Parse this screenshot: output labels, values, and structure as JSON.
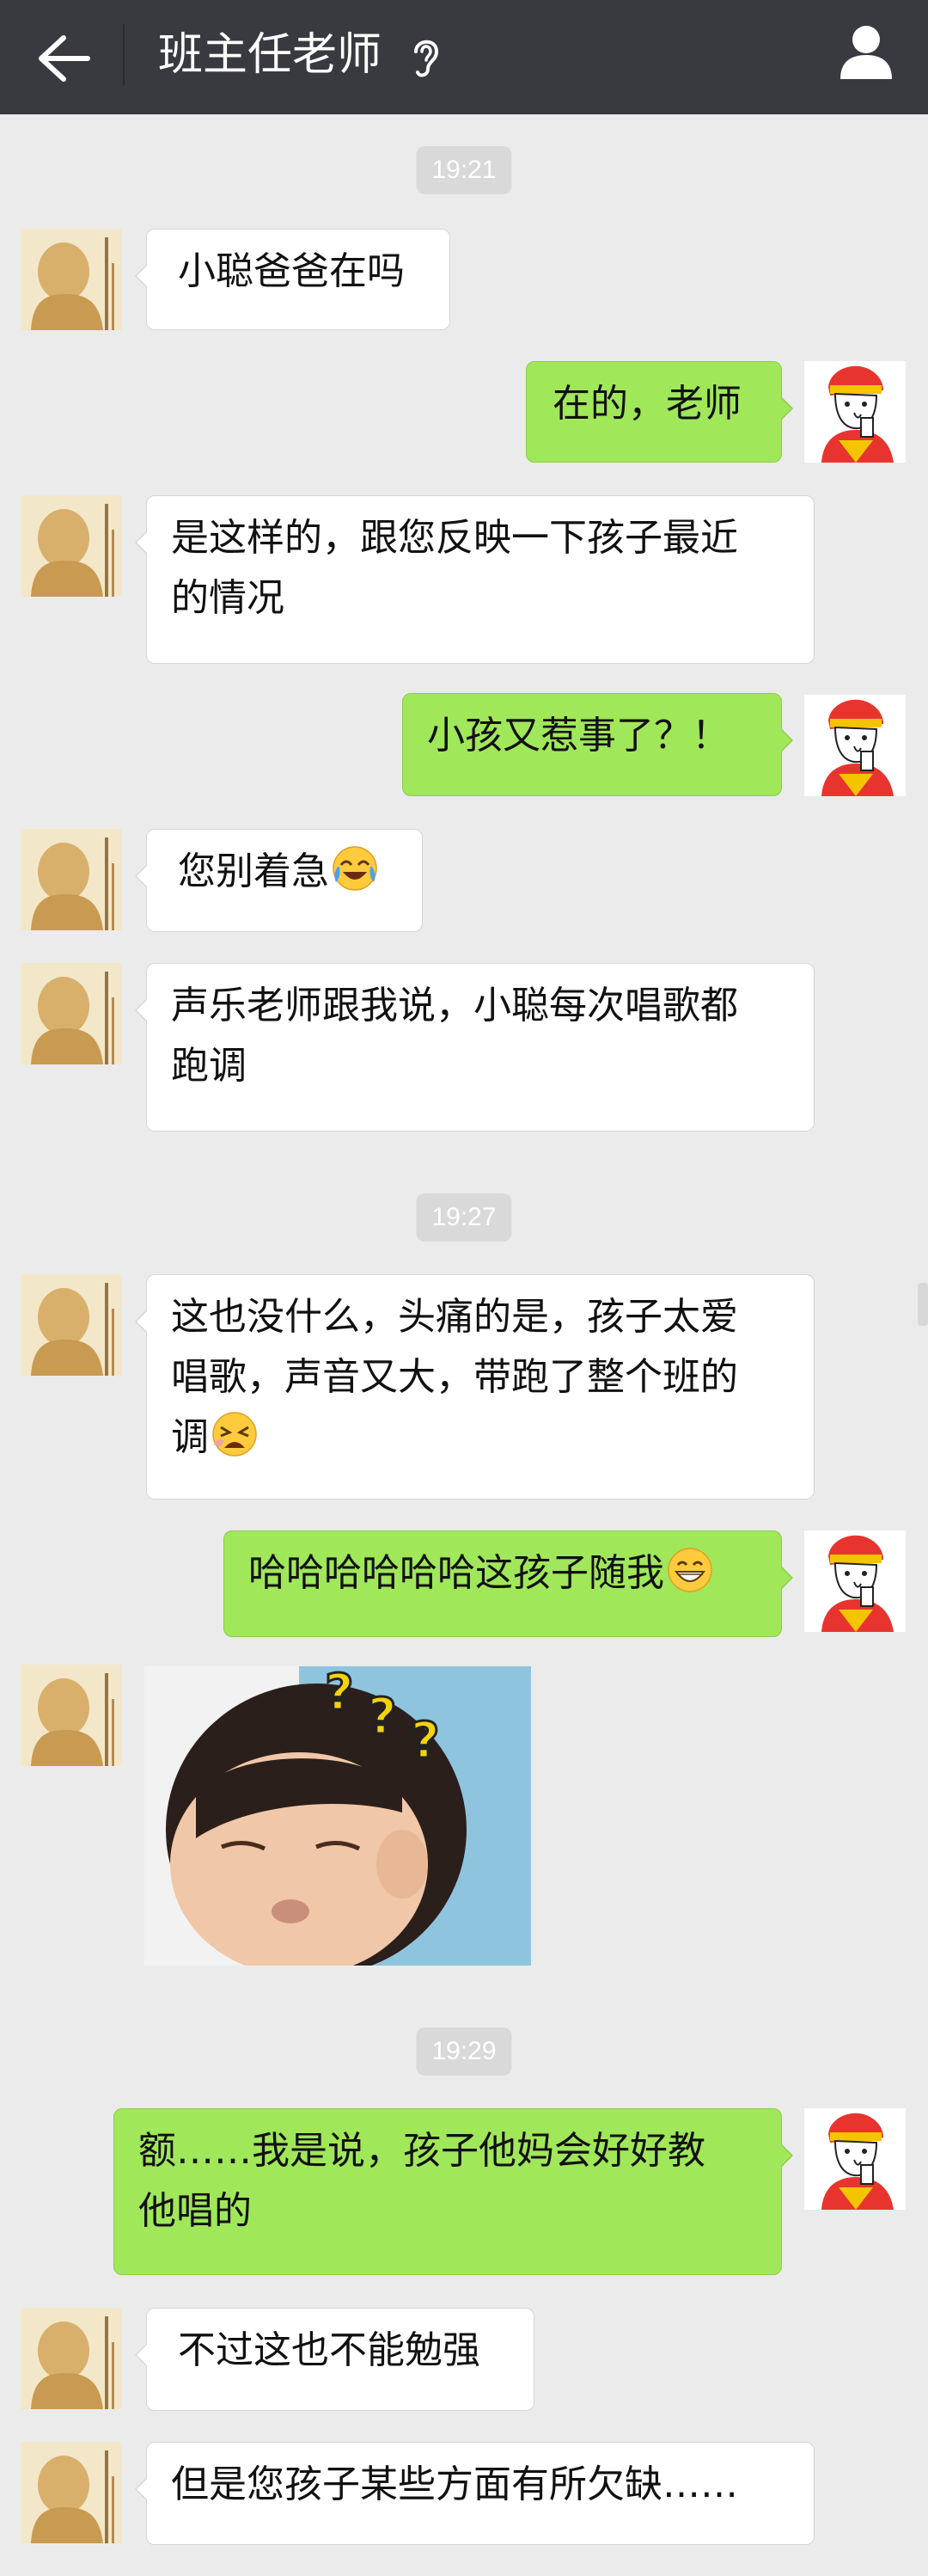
{
  "header": {
    "title": "班主任老师",
    "back_icon": "arrow-left-icon",
    "ear_icon": "ear-icon",
    "profile_icon": "user-icon"
  },
  "colors": {
    "topbar": "#393a3f",
    "background": "#ebebeb",
    "sent_bubble": "#a0e75a",
    "received_bubble": "#ffffff",
    "timestamp_bg": "#d9d9d9"
  },
  "timestamps": [
    "19:21",
    "19:27",
    "19:29"
  ],
  "messages": [
    {
      "side": "left",
      "text": "小聪爸爸在吗"
    },
    {
      "side": "right",
      "text": "在的，老师"
    },
    {
      "side": "left",
      "lines": [
        "是这样的，跟您反映一下孩子最近",
        "的情况"
      ]
    },
    {
      "side": "right",
      "text": "小孩又惹事了？！"
    },
    {
      "side": "left",
      "text": "您别着急",
      "emoji": "tears-of-joy-emoji"
    },
    {
      "side": "left",
      "lines": [
        "声乐老师跟我说，小聪每次唱歌都",
        "跑调"
      ]
    },
    {
      "side": "left",
      "lines": [
        "这也没什么，头痛的是，孩子太爱",
        "唱歌，声音又大，带跑了整个班的",
        "调"
      ],
      "emoji": "tired-face-emoji"
    },
    {
      "side": "right",
      "text": "哈哈哈哈哈哈这孩子随我",
      "emoji": "grinning-face-emoji"
    },
    {
      "side": "left",
      "type": "sticker",
      "sticker": "confused-child-sticker"
    },
    {
      "side": "right",
      "lines": [
        "额……我是说，孩子他妈会好好教",
        "他唱的"
      ]
    },
    {
      "side": "left",
      "text": "不过这也不能勉强"
    },
    {
      "side": "left",
      "text": "但是您孩子某些方面有所欠缺……"
    }
  ]
}
